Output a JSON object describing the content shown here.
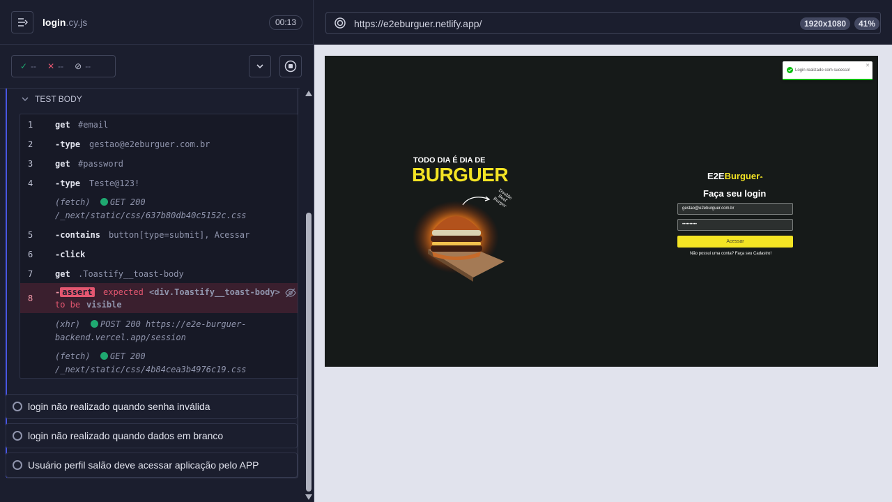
{
  "reporter": {
    "spec_name": "login",
    "spec_ext": ".cy.js",
    "timer": "00:13",
    "stats": {
      "passed": "--",
      "failed": "--",
      "pending": "--"
    },
    "test_body_label": "TEST BODY",
    "commands": [
      {
        "num": "1",
        "name": "get",
        "message": "#email"
      },
      {
        "num": "2",
        "name": "-type",
        "message": "gestao@e2eburguer.com.br"
      },
      {
        "num": "3",
        "name": "get",
        "message": "#password"
      },
      {
        "num": "4",
        "name": "-type",
        "message": "Teste@123!"
      },
      {
        "num": "",
        "name": "(fetch)",
        "method": "GET 200",
        "message": "/_next/static/css/637b80db40c5152c.css"
      },
      {
        "num": "5",
        "name": "-contains",
        "message": "button[type=submit], Acessar"
      },
      {
        "num": "6",
        "name": "-click",
        "message": ""
      },
      {
        "num": "7",
        "name": "get",
        "message": ".Toastify__toast-body"
      },
      {
        "num": "8",
        "name": "assert",
        "expected_label": "expected",
        "element": "<div.Toastify__toast-body>",
        "to_be": "to be",
        "visible": "visible"
      },
      {
        "num": "",
        "name": "(xhr)",
        "method": "POST 200",
        "message_line1": "https://e2e-burguer-",
        "message_line2": "backend.vercel.app/session"
      },
      {
        "num": "",
        "name": "(fetch)",
        "method": "GET 200",
        "message": "/_next/static/css/4b84cea3b4976c19.css"
      }
    ],
    "tests": [
      "login não realizado quando senha inválida",
      "login não realizado quando dados em branco",
      "Usuário perfil salão deve acessar aplicação pelo APP"
    ]
  },
  "aut": {
    "url": "https://e2eburguer.netlify.app/",
    "viewport": "1920x1080",
    "zoom": "41%",
    "toast_message": "Login realizado com sucesso!",
    "banner_pre": "TODO DIA É DIA DE",
    "banner_big": "BURGUER",
    "banner_script": "Double Beef Burger",
    "brand_a": "E2E",
    "brand_b": "Burguer",
    "login_title": "Faça seu login",
    "email_value": "gestao@e2eburguer.com.br",
    "password_value": "••••••••••",
    "button_label": "Acessar",
    "signup_text": "Não possui uma conta? Faça seu Cadastro!"
  },
  "colors": {
    "reporter_bg": "#1b1e2e",
    "accent": "#4956e3",
    "fail": "#e45770",
    "success": "#1fa971",
    "aut_bg": "#161a19",
    "brand_yellow": "#f4e424"
  }
}
